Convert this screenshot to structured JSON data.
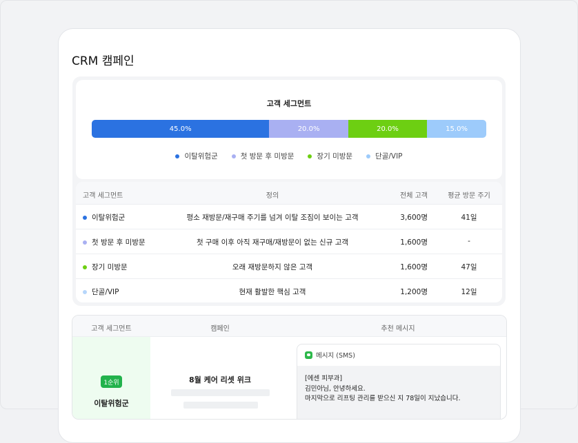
{
  "page": {
    "title": "CRM 캠페인"
  },
  "chart_data": {
    "type": "bar",
    "title": "고객 세그먼트",
    "categories": [
      "이탈위험군",
      "첫 방문 후 미방문",
      "장기 미방문",
      "단골/VIP"
    ],
    "values": [
      45.0,
      20.0,
      20.0,
      15.0
    ],
    "labels": [
      "45.0%",
      "20.0%",
      "20.0%",
      "15.0%"
    ],
    "colors": [
      "#2b72e1",
      "#a9b0f2",
      "#6dcf12",
      "#9dcbfb"
    ],
    "legend_position": "bottom"
  },
  "segment_table": {
    "headers": {
      "segment": "고객 세그먼트",
      "definition": "정의",
      "total": "전체 고객",
      "cycle": "평균 방문 주기"
    },
    "rows": [
      {
        "segment": "이탈위험군",
        "definition": "평소 재방문/재구매 주기를 넘겨 이탈 조짐이 보이는 고객",
        "total": "3,600명",
        "cycle": "41일",
        "color": "#2b72e1"
      },
      {
        "segment": "첫 방문 후 미방문",
        "definition": "첫 구매 이후 아직 재구매/재방문이 없는 신규 고객",
        "total": "1,600명",
        "cycle": "-",
        "color": "#a9b0f2"
      },
      {
        "segment": "장기 미방문",
        "definition": "오래 재방문하지 않은 고객",
        "total": "1,600명",
        "cycle": "47일",
        "color": "#6dcf12"
      },
      {
        "segment": "단골/VIP",
        "definition": "현재 활발한 핵심 고객",
        "total": "1,200명",
        "cycle": "12일",
        "color": "#b6d6fb"
      }
    ]
  },
  "campaign_table": {
    "headers": {
      "segment": "고객 세그먼트",
      "campaign": "캠페인",
      "message": "추천 메시지"
    },
    "row": {
      "rank": "1순위",
      "segment": "이탈위험군",
      "campaign": "8월 케어 리셋 위크",
      "message_type": "메시지 (SMS)",
      "message_lines": [
        "[에센 피부과]",
        "김민아님, 안녕하세요.",
        "마지막으로 리프팅 관리를 받으신 지 78일이 지났습니다."
      ]
    }
  }
}
